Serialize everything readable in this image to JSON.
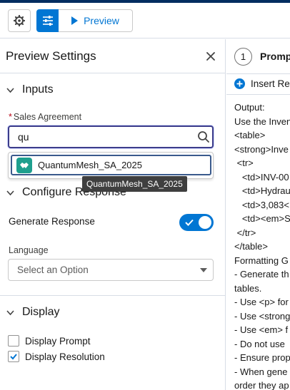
{
  "toolbar": {
    "gear_icon": "gear-icon",
    "tune_icon": "sliders-icon",
    "preview_label": "Preview"
  },
  "left_panel": {
    "title": "Preview Settings",
    "inputs_section": {
      "title": "Inputs",
      "field_label": "Sales Agreement",
      "search_value": "qu",
      "dropdown_item": "QuantumMesh_SA_2025",
      "tooltip": "QuantumMesh_SA_2025"
    },
    "configure_section": {
      "title": "Configure Response",
      "generate_label": "Generate Response",
      "generate_enabled": true,
      "language_label": "Language",
      "language_placeholder": "Select an Option"
    },
    "display_section": {
      "title": "Display",
      "options": [
        {
          "label": "Display Prompt",
          "checked": false
        },
        {
          "label": "Display Resolution",
          "checked": true
        }
      ]
    }
  },
  "right_panel": {
    "step_number": "1",
    "step_title": "Prompt",
    "insert_label": "Insert Re",
    "lines": [
      "Output:",
      "Use the Inven",
      "<table>",
      "<strong>Inve",
      " <tr>",
      "   <td>INV-00",
      "   <td>Hydrau",
      "   <td>3,083<",
      "   <td><em>S",
      " </tr>",
      "</table>",
      "Formatting G",
      "- Generate th",
      "tables.",
      "- Use <p> for",
      "- Use <strong",
      "- Use <em> f",
      "- Do not use",
      "- Ensure prop",
      "- When gene",
      "order they ap"
    ]
  },
  "colors": {
    "brand": "#0176d3",
    "header_stripe": "#032d60",
    "agreement_icon": "#1e9f8e"
  }
}
